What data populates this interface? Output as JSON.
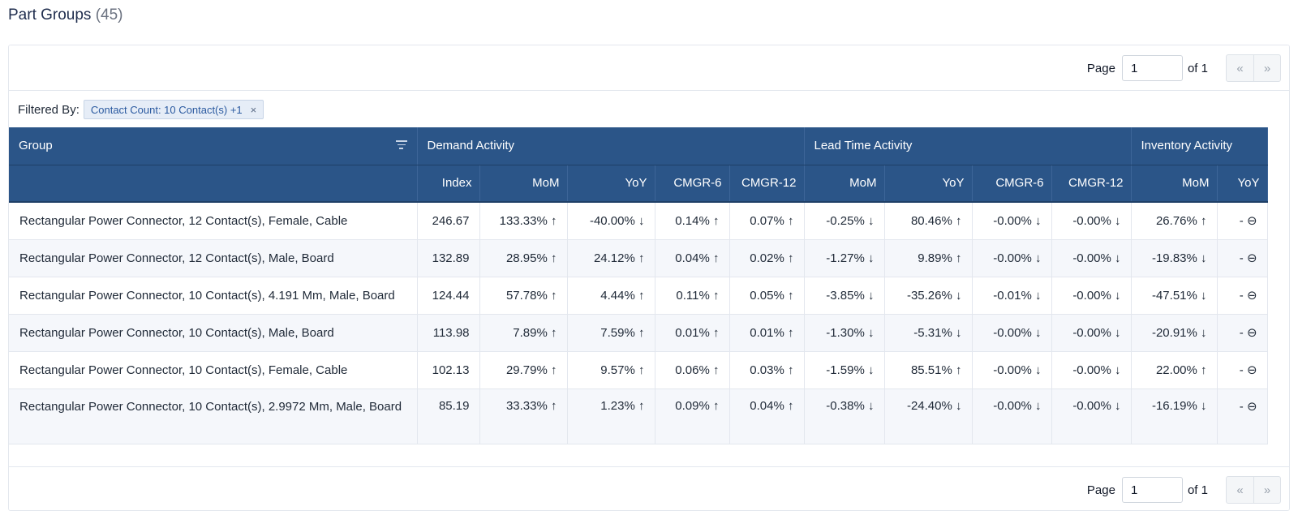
{
  "header": {
    "title": "Part Groups",
    "count": "(45)"
  },
  "pager": {
    "page_label": "Page",
    "page_value": "1",
    "of_label": "of 1",
    "prev": "«",
    "next": "»"
  },
  "filter": {
    "label": "Filtered By:",
    "chip": "Contact Count: 10 Contact(s) +1",
    "remove": "×"
  },
  "table": {
    "group_headers": [
      "Group",
      "Demand Activity",
      "Lead Time Activity",
      "Inventory Activity"
    ],
    "columns": [
      "",
      "Index",
      "MoM",
      "YoY",
      "CMGR-6",
      "CMGR-12",
      "MoM",
      "YoY",
      "CMGR-6",
      "CMGR-12",
      "MoM",
      "YoY"
    ],
    "rows": [
      [
        "Rectangular Power Connector, 12 Contact(s), Female, Cable",
        "246.67",
        "133.33% ↑",
        "-40.00% ↓",
        "0.14% ↑",
        "0.07% ↑",
        "-0.25% ↓",
        "80.46% ↑",
        "-0.00% ↓",
        "-0.00% ↓",
        "26.76% ↑",
        "- ⊖"
      ],
      [
        "Rectangular Power Connector, 12 Contact(s), Male, Board",
        "132.89",
        "28.95% ↑",
        "24.12% ↑",
        "0.04% ↑",
        "0.02% ↑",
        "-1.27% ↓",
        "9.89% ↑",
        "-0.00% ↓",
        "-0.00% ↓",
        "-19.83% ↓",
        "- ⊖"
      ],
      [
        "Rectangular Power Connector, 10 Contact(s), 4.191 Mm, Male, Board",
        "124.44",
        "57.78% ↑",
        "4.44% ↑",
        "0.11% ↑",
        "0.05% ↑",
        "-3.85% ↓",
        "-35.26% ↓",
        "-0.01% ↓",
        "-0.00% ↓",
        "-47.51% ↓",
        "- ⊖"
      ],
      [
        "Rectangular Power Connector, 10 Contact(s), Male, Board",
        "113.98",
        "7.89% ↑",
        "7.59% ↑",
        "0.01% ↑",
        "0.01% ↑",
        "-1.30% ↓",
        "-5.31% ↓",
        "-0.00% ↓",
        "-0.00% ↓",
        "-20.91% ↓",
        "- ⊖"
      ],
      [
        "Rectangular Power Connector, 10 Contact(s), Female, Cable",
        "102.13",
        "29.79% ↑",
        "9.57% ↑",
        "0.06% ↑",
        "0.03% ↑",
        "-1.59% ↓",
        "85.51% ↑",
        "-0.00% ↓",
        "-0.00% ↓",
        "22.00% ↑",
        "- ⊖"
      ],
      [
        "Rectangular Power Connector, 10 Contact(s), 2.9972 Mm, Male, Board",
        "85.19",
        "33.33% ↑",
        "1.23% ↑",
        "0.09% ↑",
        "0.04% ↑",
        "-0.38% ↓",
        "-24.40% ↓",
        "-0.00% ↓",
        "-0.00% ↓",
        "-16.19% ↓",
        "- ⊖"
      ]
    ]
  },
  "colors": {
    "header_bg": "#2b5588",
    "chip_bg": "#e6edf7",
    "chip_text": "#2b5aa0",
    "row_alt": "#f5f7fb"
  }
}
